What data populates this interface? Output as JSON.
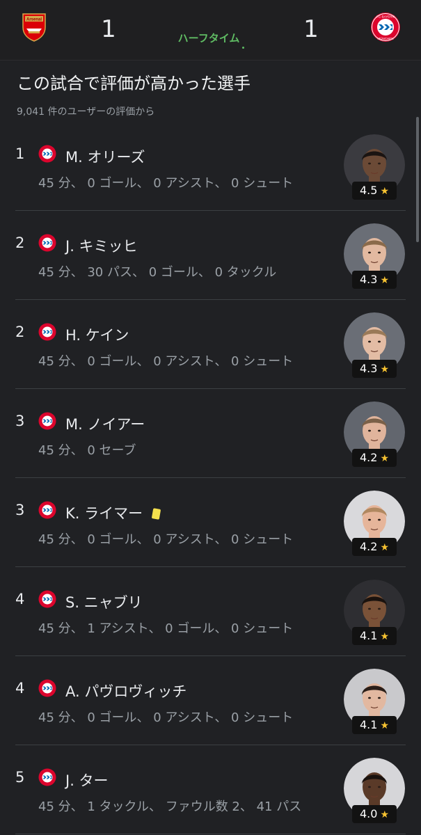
{
  "match": {
    "home": {
      "name": "Arsenal",
      "score": "1",
      "logo_icon": "arsenal-crest-icon"
    },
    "away": {
      "name": "FC Bayern München",
      "score": "1",
      "logo_icon": "bayern-crest-icon",
      "logo_text_top": "FC BAYERN",
      "logo_text_bottom": "MÜNCHEN"
    },
    "status": "ハーフタイム"
  },
  "ratings": {
    "title": "この試合で評価が高かった選手",
    "subtitle": "9,041 件のユーザーの評価から",
    "players": [
      {
        "rank": "1",
        "name": "M. オリーズ",
        "stats": "45 分、 0 ゴール、 0 アシスト、 0 シュート",
        "rating": "4.5",
        "yellow_card": false,
        "photo_bg": "#3b3b40",
        "skin": "#6b4a36",
        "hair": "#1a1412"
      },
      {
        "rank": "2",
        "name": "J. キミッヒ",
        "stats": "45 分、 30 パス、 0 ゴール、 0 タックル",
        "rating": "4.3",
        "yellow_card": false,
        "photo_bg": "#6a6e76",
        "skin": "#e2b9a0",
        "hair": "#8a6a4a"
      },
      {
        "rank": "2",
        "name": "H. ケイン",
        "stats": "45 分、 0 ゴール、 0 アシスト、 0 シュート",
        "rating": "4.3",
        "yellow_card": false,
        "photo_bg": "#6a6e76",
        "skin": "#e3bca4",
        "hair": "#9a7a58"
      },
      {
        "rank": "3",
        "name": "M. ノイアー",
        "stats": "45 分、 0 セーブ",
        "rating": "4.2",
        "yellow_card": false,
        "photo_bg": "#62666e",
        "skin": "#e0b49c",
        "hair": "#7a6048"
      },
      {
        "rank": "3",
        "name": "K. ライマー",
        "stats": "45 分、 0 ゴール、 0 アシスト、 0 シュート",
        "rating": "4.2",
        "yellow_card": true,
        "photo_bg": "#d9d9dc",
        "skin": "#e6b59a",
        "hair": "#b08860"
      },
      {
        "rank": "4",
        "name": "S. ニャブリ",
        "stats": "45 分、 1 アシスト、 0 ゴール、 0 シュート",
        "rating": "4.1",
        "yellow_card": false,
        "photo_bg": "#2e2e32",
        "skin": "#7a5238",
        "hair": "#1a120e"
      },
      {
        "rank": "4",
        "name": "A. パヴロヴィッチ",
        "stats": "45 分、 0 ゴール、 0 アシスト、 0 シュート",
        "rating": "4.1",
        "yellow_card": false,
        "photo_bg": "#c9c9cc",
        "skin": "#e2b8a0",
        "hair": "#2a1e18"
      },
      {
        "rank": "5",
        "name": "J. ター",
        "stats": "45 分、 1 タックル、 ファウル数 2、 41 パス",
        "rating": "4.0",
        "yellow_card": false,
        "photo_bg": "#d6d6d9",
        "skin": "#5a3a28",
        "hair": "#1a120e"
      }
    ]
  },
  "colors": {
    "background": "#202124",
    "status_green": "#5fbb63",
    "star": "#f6c231",
    "yellow_card": "#f4e04d",
    "bayern_red": "#dc052d",
    "arsenal_red": "#db0007"
  },
  "icons": {
    "star": "★",
    "rating_star_icon": "star-icon",
    "card_icon": "yellow-card-icon",
    "club_icon": "bayern-badge-icon"
  }
}
